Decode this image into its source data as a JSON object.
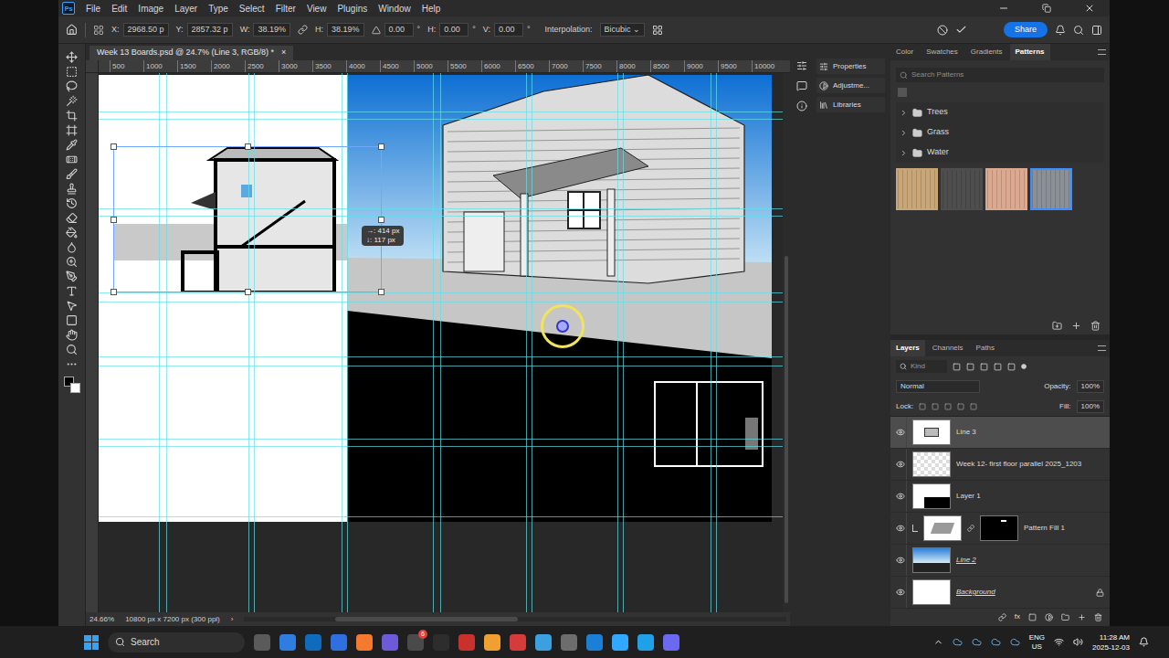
{
  "menu_bar": {
    "logo": "Ps",
    "items": [
      "File",
      "Edit",
      "Image",
      "Layer",
      "Type",
      "Select",
      "Filter",
      "View",
      "Plugins",
      "Window",
      "Help"
    ]
  },
  "options_bar": {
    "fields": [
      {
        "label": "X:",
        "value": "2968.50 p",
        "unit": ""
      },
      {
        "label": "Y:",
        "value": "2857.32 p",
        "unit": ""
      },
      {
        "label": "W:",
        "value": "38.19%",
        "unit": ""
      },
      {
        "label": "H:",
        "value": "38.19%",
        "unit": ""
      },
      {
        "label": "",
        "value": "0.00",
        "unit": "°"
      },
      {
        "label": "H:",
        "value": "0.00",
        "unit": "°"
      },
      {
        "label": "V:",
        "value": "0.00",
        "unit": "°"
      }
    ],
    "interpolation": {
      "label": "Interpolation:",
      "value": "Bicubic"
    },
    "share": "Share"
  },
  "document": {
    "tab": "Week 13 Boards.psd @ 24.7% (Line 3, RGB/8) *",
    "close": "×",
    "ruler": [
      "500",
      "1000",
      "1500",
      "2000",
      "2500",
      "3000",
      "3500",
      "4000",
      "4500",
      "5000",
      "5500",
      "6000",
      "6500",
      "7000",
      "7500",
      "8000",
      "8500",
      "9000",
      "9500",
      "10000"
    ],
    "tooltip": [
      "→: 414 px",
      "↓: 117 px"
    ]
  },
  "status_bar": {
    "zoom": "24.66%",
    "info": "10800 px x 7200 px (300 ppi)",
    "arrow": "›"
  },
  "side_panels": [
    {
      "label": "Properties"
    },
    {
      "label": "Adjustme..."
    },
    {
      "label": "Libraries"
    }
  ],
  "patterns_panel": {
    "tabs": [
      {
        "label": "Color",
        "selected": false
      },
      {
        "label": "Swatches",
        "selected": false
      },
      {
        "label": "Gradients",
        "selected": false
      },
      {
        "label": "Patterns",
        "selected": true
      }
    ],
    "search": {
      "placeholder": "Search Patterns"
    },
    "folders": [
      {
        "name": "Trees",
        "expanded": false
      },
      {
        "name": "Grass",
        "expanded": false
      },
      {
        "name": "Water",
        "expanded": false
      }
    ],
    "swatches": [
      {
        "color": "#c8a678",
        "selected": false
      },
      {
        "color": "#4e4e4e",
        "selected": false
      },
      {
        "color": "#dba98f",
        "selected": false
      },
      {
        "color": "#8b9097",
        "selected": true
      }
    ]
  },
  "layers_panel": {
    "tabs": [
      {
        "label": "Layers",
        "selected": true
      },
      {
        "label": "Channels",
        "selected": false
      },
      {
        "label": "Paths",
        "selected": false
      }
    ],
    "filter": "Kind",
    "blend_mode": "Normal",
    "opacity": {
      "label": "Opacity:",
      "value": "100%"
    },
    "lock": "Lock:",
    "fill": {
      "label": "Fill:",
      "value": "100%"
    },
    "footer_fx": "fx",
    "layers": [
      {
        "name": "Line 3",
        "selected": true,
        "visible": true,
        "italic": false,
        "locked": false,
        "clipped": false,
        "thumb": "house"
      },
      {
        "name": "Week 12- first floor parallel 2025_1203",
        "selected": false,
        "visible": true,
        "italic": false,
        "locked": false,
        "clipped": false,
        "thumb": "blank"
      },
      {
        "name": "Layer 1",
        "selected": false,
        "visible": true,
        "italic": false,
        "locked": false,
        "clipped": false,
        "thumb": "black"
      },
      {
        "name": "Pattern Fill 1",
        "selected": false,
        "visible": true,
        "italic": false,
        "locked": false,
        "clipped": true,
        "thumb": "pattern"
      },
      {
        "name": "Line 2",
        "selected": false,
        "visible": true,
        "italic": true,
        "locked": false,
        "clipped": false,
        "thumb": "sky"
      },
      {
        "name": "Background",
        "selected": false,
        "visible": true,
        "italic": true,
        "locked": true,
        "clipped": false,
        "thumb": "white"
      }
    ]
  },
  "taskbar": {
    "search": "Search",
    "badge": "6",
    "language": [
      "ENG",
      "US"
    ],
    "time": "11:28 AM",
    "date": "2025-12-03"
  }
}
